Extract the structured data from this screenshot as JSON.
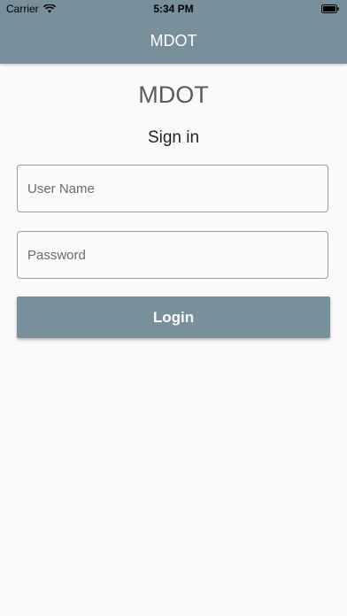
{
  "status_bar": {
    "carrier": "Carrier",
    "time": "5:34 PM",
    "icons": [
      "wifi-icon",
      "battery-icon"
    ]
  },
  "app_bar": {
    "title": "MDOT",
    "color": "#78909c"
  },
  "login_form": {
    "brand": "MDOT",
    "subtitle": "Sign in",
    "username": {
      "placeholder": "User Name",
      "value": ""
    },
    "password": {
      "placeholder": "Password",
      "value": ""
    },
    "login_label": "Login"
  }
}
